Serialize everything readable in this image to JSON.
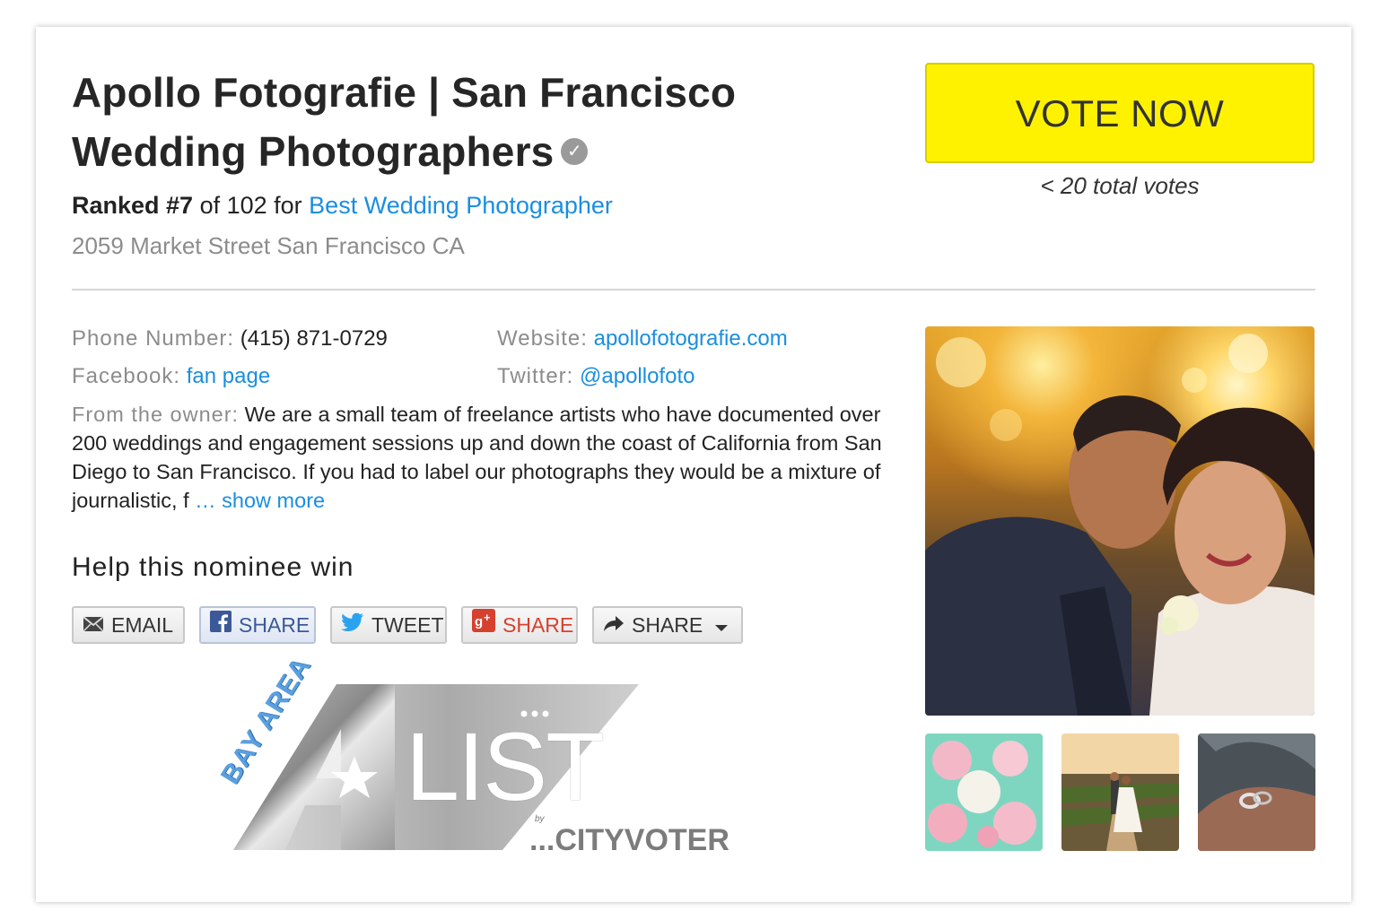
{
  "listing": {
    "title_line1": "Apollo Fotografie | San Francisco",
    "title_line2": "Wedding Photographers",
    "verified_icon": "verified-check-icon",
    "rank_label": "Ranked #7",
    "rank_of": " of 102 for ",
    "category": "Best Wedding Photographer",
    "address": "2059 Market Street San Francisco CA"
  },
  "vote": {
    "button_label": "VOTE NOW",
    "total_votes": "< 20 total votes",
    "button_color": "#fff200"
  },
  "contact": {
    "phone_label": "Phone Number:",
    "phone_value": "(415) 871-0729",
    "website_label": "Website:",
    "website_value": "apollofotografie.com",
    "facebook_label": "Facebook:",
    "facebook_value": "fan page",
    "twitter_label": "Twitter:",
    "twitter_value": "@apollofoto"
  },
  "owner": {
    "label": "From the owner:",
    "text": " We are a small team of freelance artists who have documented over 200 weddings and engagement sessions up and down the coast of California from San Diego to San Francisco. If you had to label our photographs they would be a mixture of journalistic, f",
    "show_more": "… show more"
  },
  "help": {
    "heading": "Help this nominee win",
    "buttons": [
      {
        "label": "EMAIL",
        "icon": "envelope-icon"
      },
      {
        "label": "SHARE",
        "icon": "facebook-icon"
      },
      {
        "label": "TWEET",
        "icon": "twitter-bird-icon"
      },
      {
        "label": "SHARE",
        "icon": "google-plus-icon"
      },
      {
        "label": "SHARE",
        "icon": "share-arrow-icon"
      }
    ]
  },
  "badge": {
    "bay_area": "BAY AREA",
    "list": "LIST",
    "by": "by",
    "cityvoter": "...CITYVOTER"
  },
  "colors": {
    "link": "#1a8ee0",
    "label_gray": "#8c8c8c",
    "facebook": "#3b5998",
    "google_plus": "#d6402f"
  }
}
